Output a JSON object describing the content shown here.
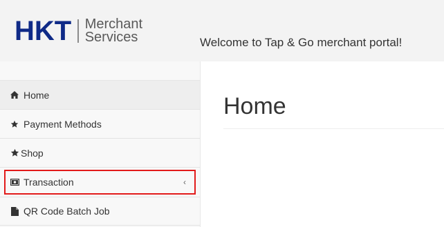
{
  "brand": {
    "logo_mark": "HKT",
    "logo_line1": "Merchant",
    "logo_line2": "Services",
    "primary_color": "#0f2a87"
  },
  "header": {
    "welcome_text": "Welcome to Tap & Go merchant portal!"
  },
  "sidebar": {
    "items": [
      {
        "label": "Home",
        "icon": "home-icon",
        "active": true
      },
      {
        "label": "Payment Methods",
        "icon": "star-icon"
      },
      {
        "label": "Shop",
        "icon": "star-icon"
      },
      {
        "label": "Transaction",
        "icon": "money-icon",
        "has_submenu": true,
        "highlighted": true,
        "highlight_color": "#e21a1a"
      },
      {
        "label": "QR Code Batch Job",
        "icon": "file-icon"
      }
    ],
    "submenu_indicator": "‹"
  },
  "main": {
    "page_title": "Home"
  }
}
